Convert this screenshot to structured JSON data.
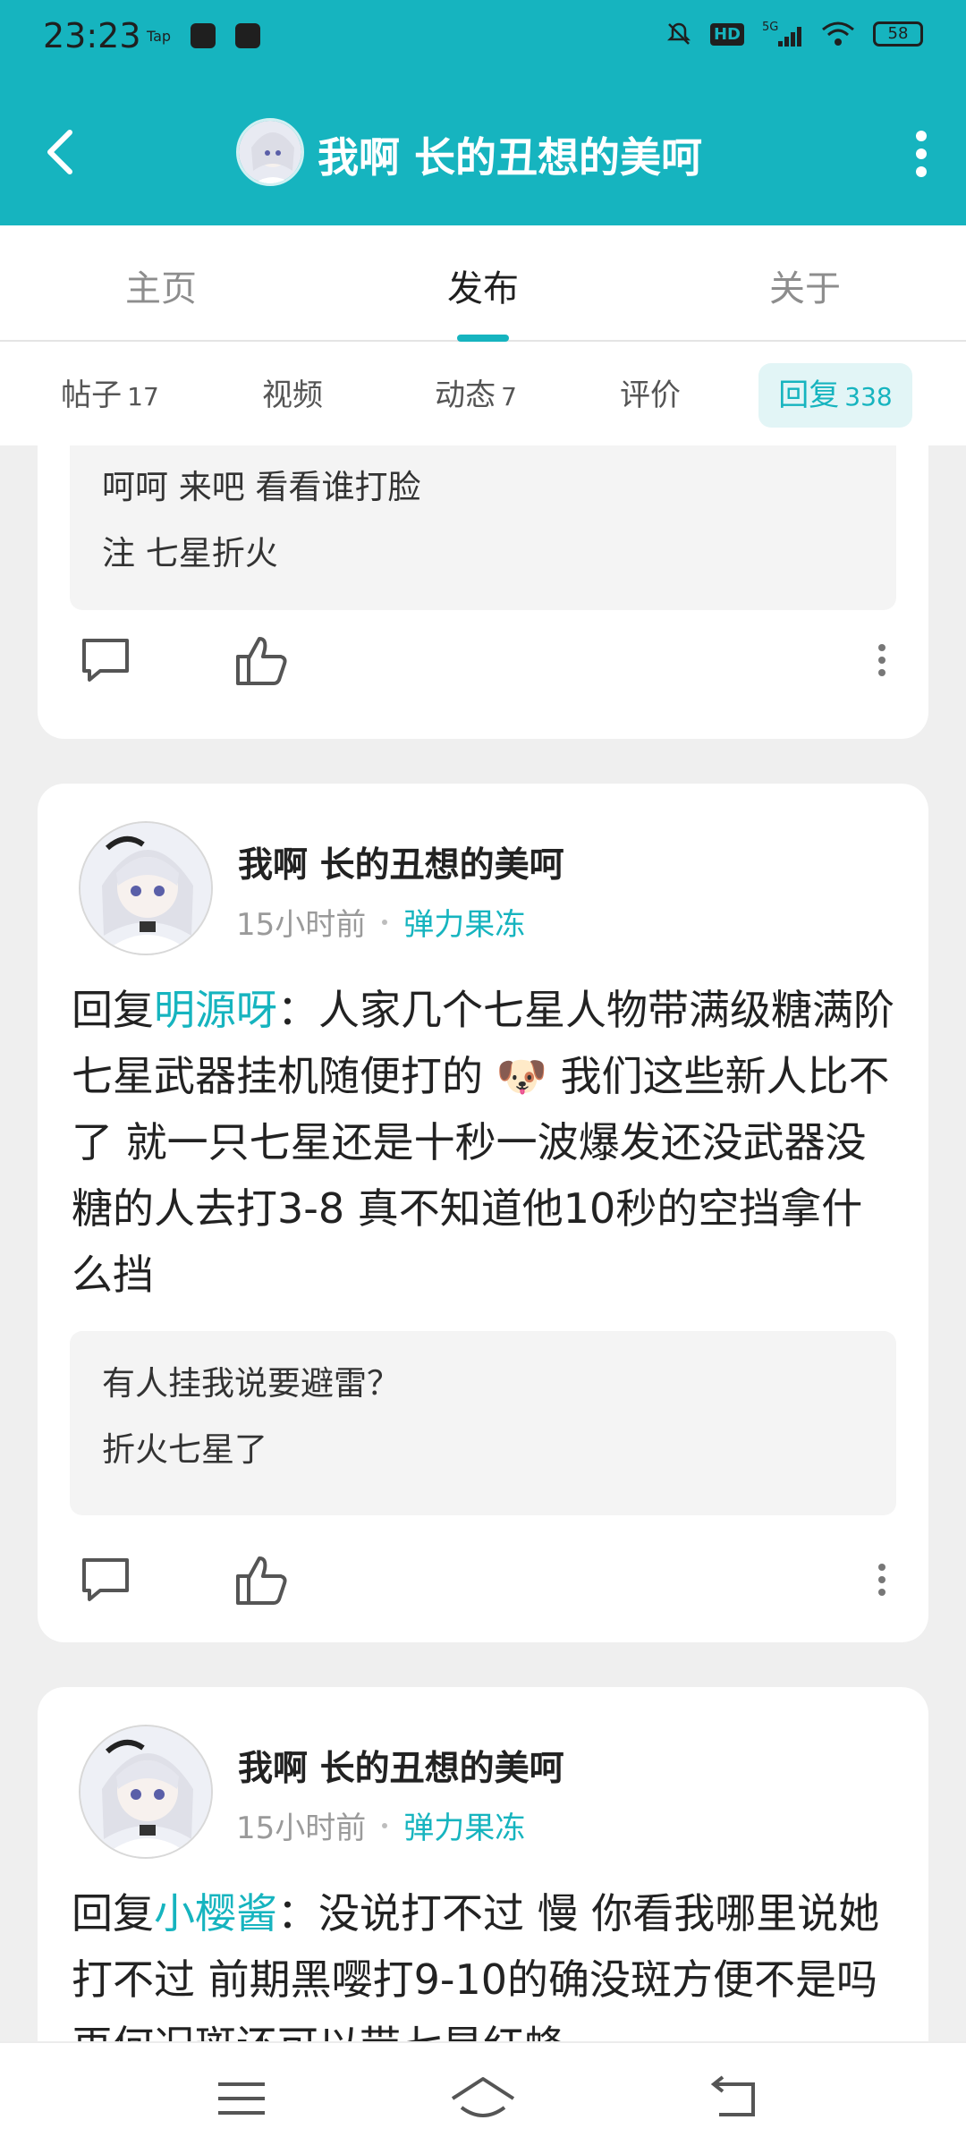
{
  "status_bar": {
    "time": "23:23",
    "left_icons": [
      "tap-icon",
      "card-icon",
      "cat-icon"
    ],
    "right_icons": [
      "mute-icon",
      "hd-icon",
      "signal-5g-icon",
      "wifi-icon"
    ],
    "battery": "58"
  },
  "header": {
    "title": "我啊 长的丑想的美呵"
  },
  "tabs": [
    {
      "label": "主页"
    },
    {
      "label": "发布"
    },
    {
      "label": "关于"
    }
  ],
  "subtabs": [
    {
      "label": "帖子",
      "count": "17"
    },
    {
      "label": "视频",
      "count": ""
    },
    {
      "label": "动态",
      "count": "7"
    },
    {
      "label": "评价",
      "count": ""
    },
    {
      "label": "回复",
      "count": "338"
    }
  ],
  "posts": [
    {
      "quote": [
        "呵呵  来吧  看看谁打脸",
        "注  七星折火"
      ]
    },
    {
      "author": "我啊 长的丑想的美呵",
      "time": "15小时前",
      "game": "弹力果冻",
      "reply_prefix": "回复",
      "mention": "明源呀",
      "body": "：人家几个七星人物带满级糖满阶七星武器挂机随便打的 🐶 我们这些新人比不了 就一只七星还是十秒一波爆发还没武器没糖的人去打3-8 真不知道他10秒的空挡拿什么挡",
      "quote": [
        "有人挂我说要避雷？",
        "折火七星了"
      ]
    },
    {
      "author": "我啊 长的丑想的美呵",
      "time": "15小时前",
      "game": "弹力果冻",
      "reply_prefix": "回复",
      "mention": "小樱酱",
      "body": "：没说打不过 慢 你看我哪里说她打不过 前期黑嘤打9-10的确没斑方便不是吗 再何况斑还可以带七星红蜂"
    }
  ],
  "colors": {
    "accent": "#16b4bf",
    "header_bg": "#16b4bf",
    "feed_bg": "#efefef"
  }
}
